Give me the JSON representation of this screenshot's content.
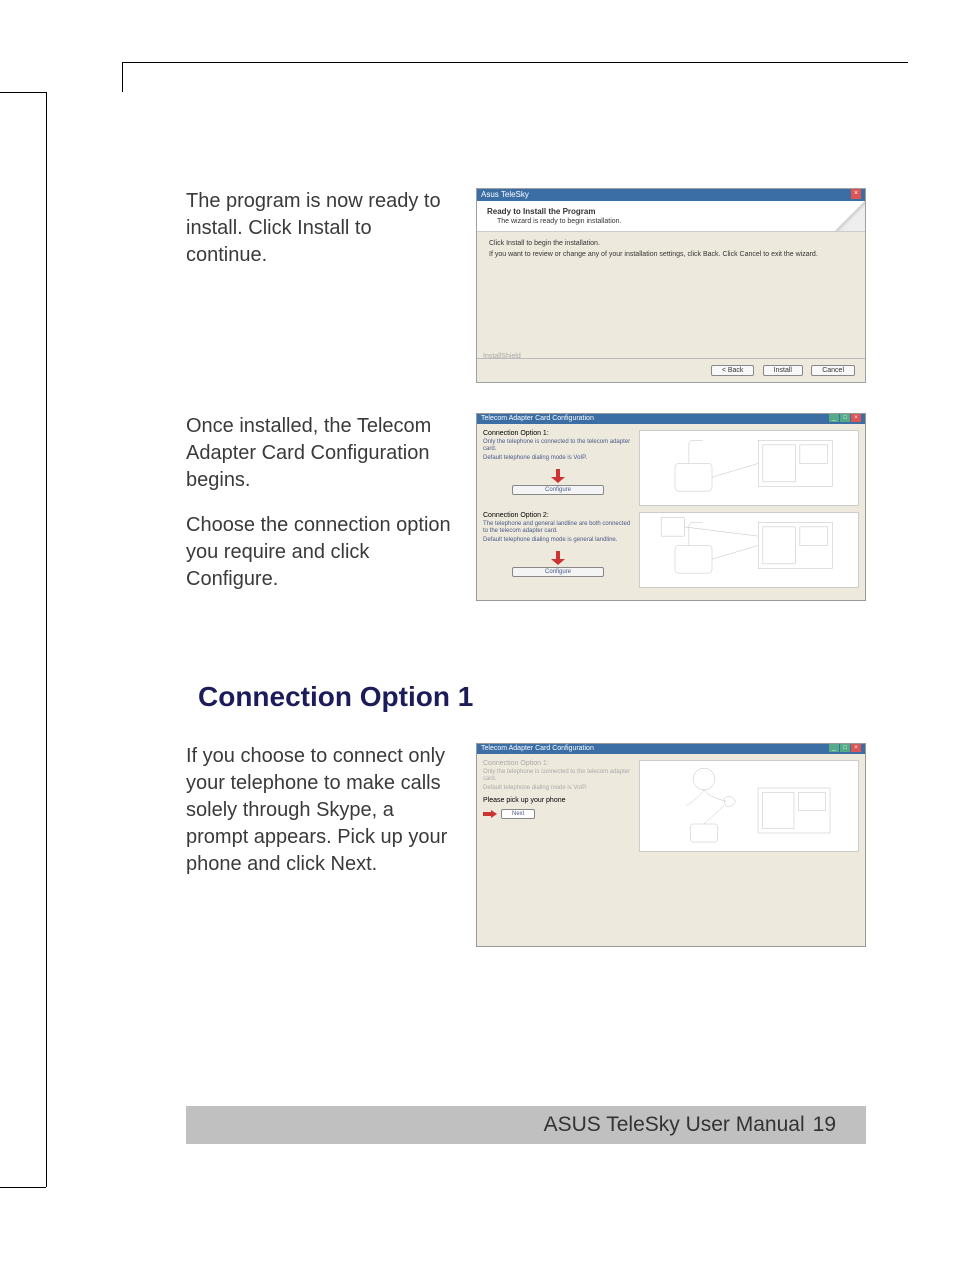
{
  "step1": {
    "text": "The program is now ready to install. Click Install to continue.",
    "dialog": {
      "title": "Asus TeleSky",
      "heading": "Ready to Install the Program",
      "sub": "The wizard is ready to begin installation.",
      "body1": "Click Install to begin the installation.",
      "body2": "If you want to review or change any of your installation settings, click Back. Click Cancel to exit the wizard.",
      "brand": "InstallShield",
      "back": "< Back",
      "install": "Install",
      "cancel": "Cancel"
    }
  },
  "step2": {
    "text1": "Once installed, the Telecom Adapter Card Configuration begins.",
    "text2": "Choose the connection option you require and click Configure.",
    "dialog": {
      "title": "Telecom Adapter Card Configuration",
      "opt1_title": "Connection Option 1:",
      "opt1_l1": "Only the telephone is connected to the telecom adapter card.",
      "opt1_l2": "Default telephone dialing mode is VoIP.",
      "opt2_title": "Connection Option 2:",
      "opt2_l1": "The telephone and general landline are both connected to the telecom adapter card.",
      "opt2_l2": "Default telephone dialing mode is general landline.",
      "configure": "Configure"
    }
  },
  "section_title": "Connection Option 1",
  "step3": {
    "text": "If you choose to connect only your telephone to make calls solely through Skype, a prompt appears. Pick up your phone and click Next.",
    "dialog": {
      "title": "Telecom Adapter Card Configuration",
      "opt1_title": "Connection Option 1:",
      "opt1_l1": "Only the telephone is connected to the telecom adapter card.",
      "opt1_l2": "Default telephone dialing mode is VoIP.",
      "instruction": "Please pick up your phone",
      "next": "Next"
    }
  },
  "footer": {
    "label": "ASUS TeleSky User Manual",
    "page": "19"
  }
}
